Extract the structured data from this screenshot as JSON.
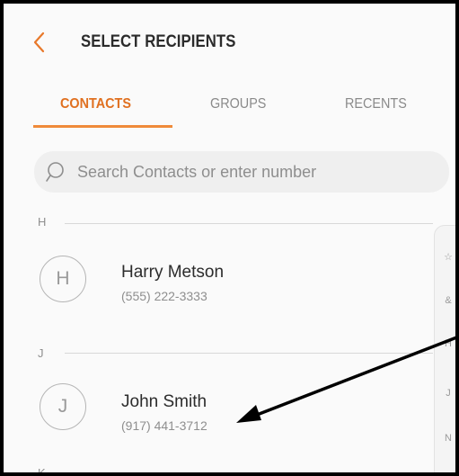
{
  "header": {
    "title": "SELECT RECIPIENTS",
    "back_icon": "chevron-left-icon",
    "accent_color": "#e8782a"
  },
  "tabs": [
    {
      "label": "CONTACTS",
      "active": true
    },
    {
      "label": "GROUPS",
      "active": false
    },
    {
      "label": "RECENTS",
      "active": false
    }
  ],
  "search": {
    "placeholder": "Search Contacts or enter number",
    "icon": "search-icon"
  },
  "sections": [
    {
      "letter": "H",
      "contacts": [
        {
          "initial": "H",
          "name": "Harry Metson",
          "phone": "(555) 222-3333"
        }
      ]
    },
    {
      "letter": "J",
      "contacts": [
        {
          "initial": "J",
          "name": "John Smith",
          "phone": "(917) 441-3712"
        }
      ]
    },
    {
      "letter": "K",
      "contacts": []
    }
  ],
  "index_bar": [
    "☆",
    "&",
    "H",
    "J",
    "N"
  ],
  "annotation": {
    "arrow_color": "#000000",
    "points_to": "John Smith phone number"
  }
}
